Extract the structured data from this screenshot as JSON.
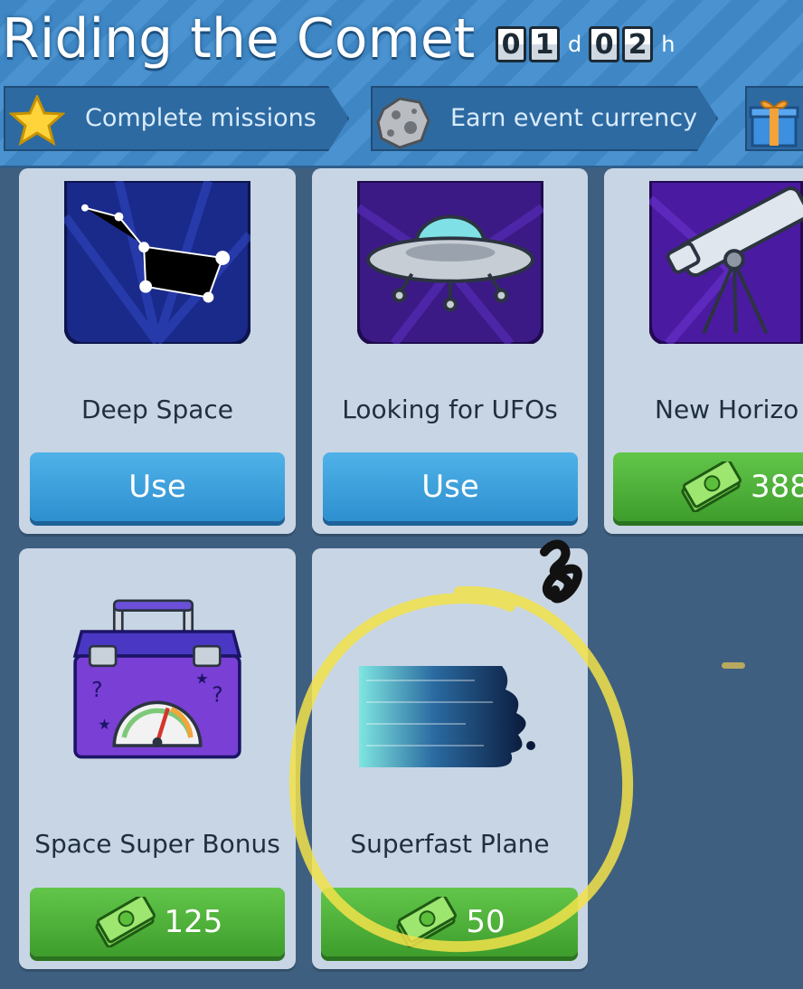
{
  "header": {
    "title": "Riding the Comet",
    "timer": {
      "days": [
        "0",
        "1"
      ],
      "days_unit": "d",
      "hours": [
        "0",
        "2"
      ],
      "hours_unit": "h"
    },
    "steps": [
      {
        "label": "Complete missions",
        "icon": "star-icon"
      },
      {
        "label": "Earn event currency",
        "icon": "asteroid-icon"
      },
      {
        "label": "",
        "icon": "gift-icon"
      }
    ]
  },
  "items": [
    {
      "name": "Deep Space",
      "action": "Use",
      "button": "use",
      "icon": "constellation-icon"
    },
    {
      "name": "Looking for UFOs",
      "action": "Use",
      "button": "use",
      "icon": "ufo-icon"
    },
    {
      "name": "New Horizo",
      "action": "388",
      "button": "price",
      "icon": "telescope-icon"
    },
    {
      "name": "Space Super Bonus",
      "action": "125",
      "button": "price",
      "icon": "bonus-chest-icon"
    },
    {
      "name": "Superfast Plane",
      "action": "50",
      "button": "price",
      "icon": "speed-streak-icon"
    }
  ],
  "colors": {
    "header_blue": "#3e86c4",
    "use_button": "#2e8fcf",
    "price_button": "#3e9d2c",
    "card_bg": "#c8d5e4",
    "highlight_ring": "#f2e24a"
  }
}
